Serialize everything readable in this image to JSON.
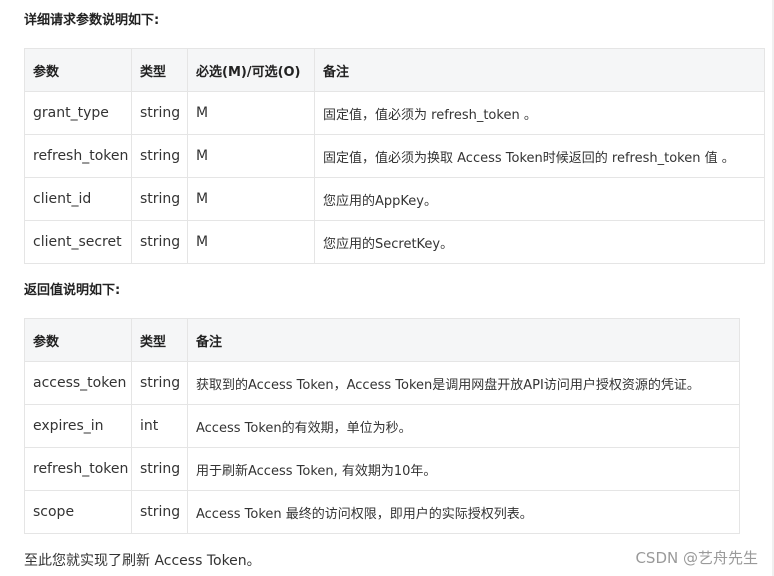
{
  "request_section": {
    "title": "详细请求参数说明如下:",
    "headers": [
      "参数",
      "类型",
      "必选(M)/可选(O)",
      "备注"
    ],
    "rows": [
      [
        "grant_type",
        "string",
        "M",
        "固定值，值必须为 refresh_token 。"
      ],
      [
        "refresh_token",
        "string",
        "M",
        "固定值，值必须为换取 Access Token时候返回的 refresh_token 值 。"
      ],
      [
        "client_id",
        "string",
        "M",
        "您应用的AppKey。"
      ],
      [
        "client_secret",
        "string",
        "M",
        "您应用的SecretKey。"
      ]
    ]
  },
  "response_section": {
    "title": "返回值说明如下:",
    "headers": [
      "参数",
      "类型",
      "备注"
    ],
    "rows": [
      [
        "access_token",
        "string",
        "获取到的Access Token，Access Token是调用网盘开放API访问用户授权资源的凭证。"
      ],
      [
        "expires_in",
        "int",
        "Access Token的有效期，单位为秒。"
      ],
      [
        "refresh_token",
        "string",
        "用于刷新Access Token, 有效期为10年。"
      ],
      [
        "scope",
        "string",
        "Access Token 最终的访问权限，即用户的实际授权列表。"
      ]
    ]
  },
  "footer_text": "至此您就实现了刷新 Access Token。",
  "watermark": "CSDN @艺舟先生"
}
